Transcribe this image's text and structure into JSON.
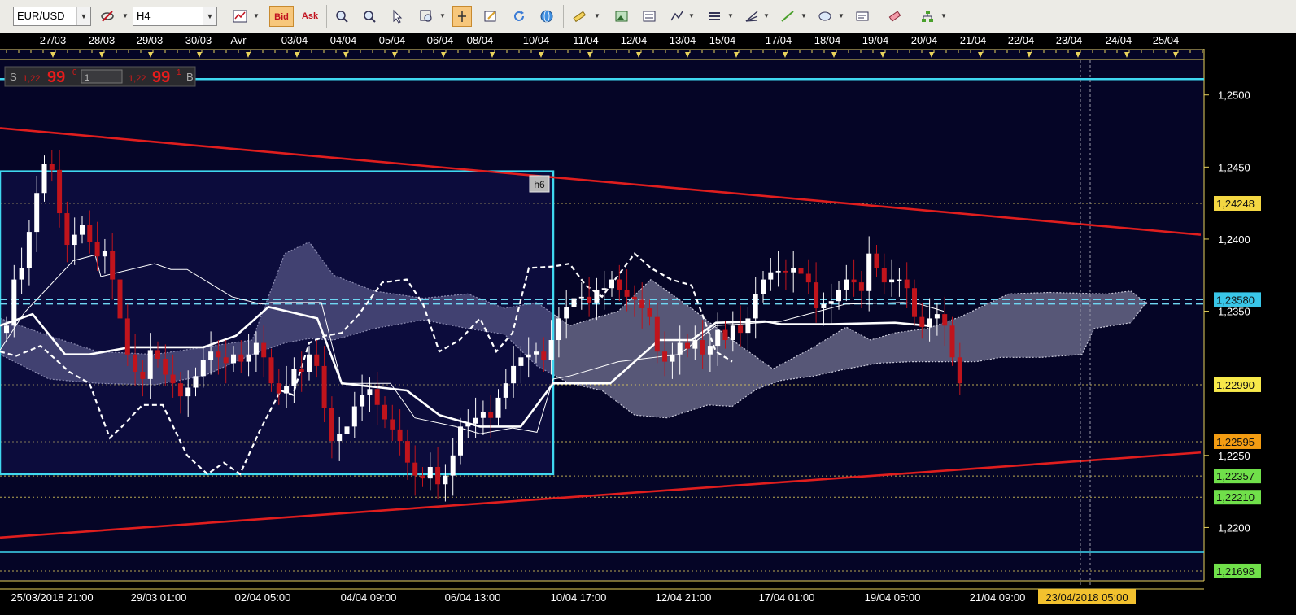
{
  "toolbar": {
    "symbol": "EUR/USD",
    "timeframe": "H4",
    "bid_label": "Bid",
    "ask_label": "Ask"
  },
  "quote_panel": {
    "sell_prefix": "S",
    "sell_small": "1,22",
    "sell_big": "99",
    "sell_sup": "0",
    "lot": "1",
    "buy_small": "1,22",
    "buy_big": "99",
    "buy_sup": "1",
    "buy_suffix": "B"
  },
  "marker_label": "h6",
  "crosshair_time": "23/04/2018 05:00",
  "colors": {
    "background": "#050526",
    "frame": "#e8d25c",
    "bull_candle": "#ffffff",
    "bear_candle": "#c0141c",
    "trendline": "#e01e1e",
    "horizontal": "#3fd8f0",
    "cloud": "#6e6e8e"
  },
  "chart_data": {
    "type": "candlestick",
    "symbol": "EUR/USD",
    "timeframe": "H4",
    "ylim": [
      1.2163,
      1.2532
    ],
    "y_ticks": [
      "1,2500",
      "1,2450",
      "1,2400",
      "1,2350",
      "1,2250",
      "1,2200"
    ],
    "top_dates": [
      "27/03",
      "28/03",
      "29/03",
      "30/03",
      "Avr",
      "03/04",
      "04/04",
      "05/04",
      "06/04",
      "08/04",
      "10/04",
      "11/04",
      "12/04",
      "13/04",
      "15/04",
      "17/04",
      "18/04",
      "19/04",
      "20/04",
      "21/04",
      "22/04",
      "23/04",
      "24/04",
      "25/04"
    ],
    "bottom_times": [
      "25/03/2018 21:00",
      "29/03 01:00",
      "02/04 05:00",
      "04/04 09:00",
      "06/04 13:00",
      "10/04 17:00",
      "12/04 21:00",
      "17/04 01:00",
      "19/04 05:00",
      "21/04 09:00"
    ],
    "price_labels": [
      {
        "text": "1,24248",
        "value": 1.24248,
        "color": "#f4d742"
      },
      {
        "text": "1,23580",
        "value": 1.2358,
        "color": "#39c6e8"
      },
      {
        "text": "1,22990",
        "value": 1.2299,
        "color": "#f7e94a"
      },
      {
        "text": "1,22595",
        "value": 1.22595,
        "color": "#f39c12"
      },
      {
        "text": "1,22357",
        "value": 1.22357,
        "color": "#70e04a"
      },
      {
        "text": "1,22210",
        "value": 1.2221,
        "color": "#70e04a"
      },
      {
        "text": "1,21698",
        "value": 1.21698,
        "color": "#70e04a"
      }
    ],
    "horizontal_lines": [
      1.2511,
      1.2183
    ],
    "dashed_lines": [
      1.2358,
      1.2355
    ],
    "dotted_levels": [
      1.24248,
      1.2299,
      1.22595,
      1.22357,
      1.2221,
      1.21698
    ],
    "trendlines": [
      {
        "from": [
          0,
          1.2477
        ],
        "to": [
          1476,
          1.2403
        ]
      },
      {
        "from": [
          0,
          1.2193
        ],
        "to": [
          1476,
          1.2252
        ]
      }
    ],
    "box": {
      "from": [
        0,
        1.2447
      ],
      "to": [
        680,
        1.2237
      ]
    },
    "closes": [
      1.234,
      1.2372,
      1.238,
      1.2405,
      1.2432,
      1.2452,
      1.2448,
      1.2418,
      1.2396,
      1.2403,
      1.241,
      1.2398,
      1.2388,
      1.2392,
      1.2372,
      1.2345,
      1.232,
      1.2308,
      1.2303,
      1.2323,
      1.2317,
      1.2306,
      1.23,
      1.2291,
      1.2297,
      1.2305,
      1.2316,
      1.2322,
      1.2318,
      1.2314,
      1.232,
      1.2315,
      1.232,
      1.2328,
      1.2318,
      1.23,
      1.2293,
      1.2298,
      1.231,
      1.2308,
      1.232,
      1.2312,
      1.2283,
      1.226,
      1.2265,
      1.227,
      1.2284,
      1.2292,
      1.2296,
      1.2285,
      1.2275,
      1.2268,
      1.226,
      1.2245,
      1.2236,
      1.2234,
      1.2242,
      1.223,
      1.2236,
      1.225,
      1.227,
      1.2272,
      1.2276,
      1.228,
      1.2276,
      1.229,
      1.23,
      1.2312,
      1.2318,
      1.232,
      1.2322,
      1.2316,
      1.233,
      1.2345,
      1.2353,
      1.2359,
      1.236,
      1.2356,
      1.2365,
      1.2366,
      1.2372,
      1.2365,
      1.236,
      1.2358,
      1.2352,
      1.2346,
      1.2322,
      1.2315,
      1.232,
      1.2328,
      1.2324,
      1.233,
      1.232,
      1.2326,
      1.2337,
      1.233,
      1.234,
      1.2335,
      1.2345,
      1.2362,
      1.2372,
      1.2377,
      1.2378,
      1.2377,
      1.238,
      1.2376,
      1.237,
      1.2352,
      1.2355,
      1.2357,
      1.2365,
      1.2372,
      1.237,
      1.2364,
      1.239,
      1.238,
      1.237,
      1.2372,
      1.2372,
      1.2366,
      1.2346,
      1.2339,
      1.2345,
      1.2348,
      1.234,
      1.2318,
      1.23
    ],
    "ichimoku": {
      "tenkan": [
        [
          0,
          1.2323
        ],
        [
          30,
          1.2349
        ],
        [
          90,
          1.2385
        ],
        [
          117,
          1.2389
        ],
        [
          124,
          1.2374
        ],
        [
          190,
          1.2383
        ],
        [
          210,
          1.2379
        ],
        [
          230,
          1.2379
        ],
        [
          285,
          1.236
        ],
        [
          320,
          1.2355
        ],
        [
          333,
          1.2356
        ],
        [
          395,
          1.2356
        ],
        [
          420,
          1.23
        ],
        [
          480,
          1.23
        ],
        [
          510,
          1.2276
        ],
        [
          560,
          1.227
        ],
        [
          590,
          1.2265
        ],
        [
          630,
          1.2269
        ],
        [
          660,
          1.2266
        ],
        [
          680,
          1.2303
        ],
        [
          700,
          1.2305
        ],
        [
          760,
          1.2315
        ],
        [
          835,
          1.232
        ],
        [
          880,
          1.234
        ],
        [
          960,
          1.2343
        ],
        [
          1040,
          1.2355
        ],
        [
          1110,
          1.2356
        ],
        [
          1130,
          1.2355
        ],
        [
          1160,
          1.235
        ]
      ],
      "kijun": [
        [
          0,
          1.234
        ],
        [
          40,
          1.2348
        ],
        [
          80,
          1.232
        ],
        [
          110,
          1.232
        ],
        [
          160,
          1.2325
        ],
        [
          250,
          1.2325
        ],
        [
          290,
          1.2333
        ],
        [
          330,
          1.2353
        ],
        [
          390,
          1.2345
        ],
        [
          420,
          1.23
        ],
        [
          500,
          1.2295
        ],
        [
          540,
          1.2278
        ],
        [
          590,
          1.227
        ],
        [
          640,
          1.227
        ],
        [
          680,
          1.23
        ],
        [
          710,
          1.23
        ],
        [
          750,
          1.23
        ],
        [
          810,
          1.233
        ],
        [
          850,
          1.233
        ],
        [
          880,
          1.2342
        ],
        [
          940,
          1.2343
        ],
        [
          960,
          1.2341
        ],
        [
          1020,
          1.2341
        ],
        [
          1100,
          1.2342
        ],
        [
          1140,
          1.234
        ]
      ],
      "chikou": [
        [
          0,
          1.2322
        ],
        [
          20,
          1.2319
        ],
        [
          50,
          1.2326
        ],
        [
          85,
          1.2308
        ],
        [
          110,
          1.23
        ],
        [
          135,
          1.2262
        ],
        [
          150,
          1.227
        ],
        [
          175,
          1.2285
        ],
        [
          200,
          1.2285
        ],
        [
          230,
          1.225
        ],
        [
          255,
          1.2237
        ],
        [
          275,
          1.2245
        ],
        [
          295,
          1.2237
        ],
        [
          320,
          1.2268
        ],
        [
          345,
          1.2295
        ],
        [
          360,
          1.2292
        ],
        [
          380,
          1.2328
        ],
        [
          400,
          1.2333
        ],
        [
          420,
          1.2335
        ],
        [
          440,
          1.2347
        ],
        [
          470,
          1.237
        ],
        [
          500,
          1.2372
        ],
        [
          520,
          1.2355
        ],
        [
          540,
          1.2322
        ],
        [
          565,
          1.233
        ],
        [
          590,
          1.2345
        ],
        [
          610,
          1.2322
        ],
        [
          630,
          1.2335
        ],
        [
          650,
          1.238
        ],
        [
          680,
          1.2381
        ],
        [
          700,
          1.2383
        ],
        [
          720,
          1.2368
        ],
        [
          740,
          1.236
        ],
        [
          780,
          1.239
        ],
        [
          800,
          1.238
        ],
        [
          825,
          1.2372
        ],
        [
          850,
          1.2368
        ],
        [
          880,
          1.2322
        ],
        [
          900,
          1.2315
        ]
      ],
      "span_a": [
        [
          0,
          1.2345
        ],
        [
          60,
          1.2333
        ],
        [
          120,
          1.2322
        ],
        [
          190,
          1.232
        ],
        [
          250,
          1.2325
        ],
        [
          310,
          1.233
        ],
        [
          350,
          1.239
        ],
        [
          380,
          1.2398
        ],
        [
          410,
          1.2375
        ],
        [
          460,
          1.2364
        ],
        [
          520,
          1.2359
        ],
        [
          575,
          1.2362
        ],
        [
          620,
          1.2352
        ],
        [
          660,
          1.2356
        ],
        [
          700,
          1.234
        ],
        [
          760,
          1.235
        ],
        [
          800,
          1.2372
        ],
        [
          850,
          1.2352
        ],
        [
          900,
          1.233
        ],
        [
          950,
          1.231
        ],
        [
          1000,
          1.2325
        ],
        [
          1040,
          1.2339
        ],
        [
          1070,
          1.233
        ],
        [
          1100,
          1.2335
        ],
        [
          1140,
          1.2338
        ],
        [
          1180,
          1.2346
        ],
        [
          1240,
          1.2362
        ],
        [
          1290,
          1.2363
        ],
        [
          1360,
          1.2362
        ],
        [
          1390,
          1.2364
        ],
        [
          1410,
          1.2355
        ]
      ],
      "span_b": [
        [
          0,
          1.232
        ],
        [
          60,
          1.2303
        ],
        [
          120,
          1.23
        ],
        [
          190,
          1.2299
        ],
        [
          250,
          1.2305
        ],
        [
          310,
          1.232
        ],
        [
          350,
          1.2328
        ],
        [
          380,
          1.2331
        ],
        [
          410,
          1.233
        ],
        [
          460,
          1.2338
        ],
        [
          520,
          1.2344
        ],
        [
          575,
          1.2338
        ],
        [
          620,
          1.2334
        ],
        [
          660,
          1.2312
        ],
        [
          700,
          1.23
        ],
        [
          740,
          1.2295
        ],
        [
          780,
          1.2278
        ],
        [
          820,
          1.2276
        ],
        [
          870,
          1.2285
        ],
        [
          900,
          1.2284
        ],
        [
          930,
          1.2296
        ],
        [
          960,
          1.2302
        ],
        [
          1000,
          1.2305
        ],
        [
          1040,
          1.231
        ],
        [
          1080,
          1.2314
        ],
        [
          1120,
          1.2315
        ],
        [
          1160,
          1.2315
        ],
        [
          1200,
          1.2315
        ],
        [
          1230,
          1.2318
        ],
        [
          1280,
          1.2318
        ],
        [
          1330,
          1.232
        ],
        [
          1345,
          1.2338
        ],
        [
          1390,
          1.2342
        ],
        [
          1410,
          1.2357
        ]
      ]
    }
  }
}
